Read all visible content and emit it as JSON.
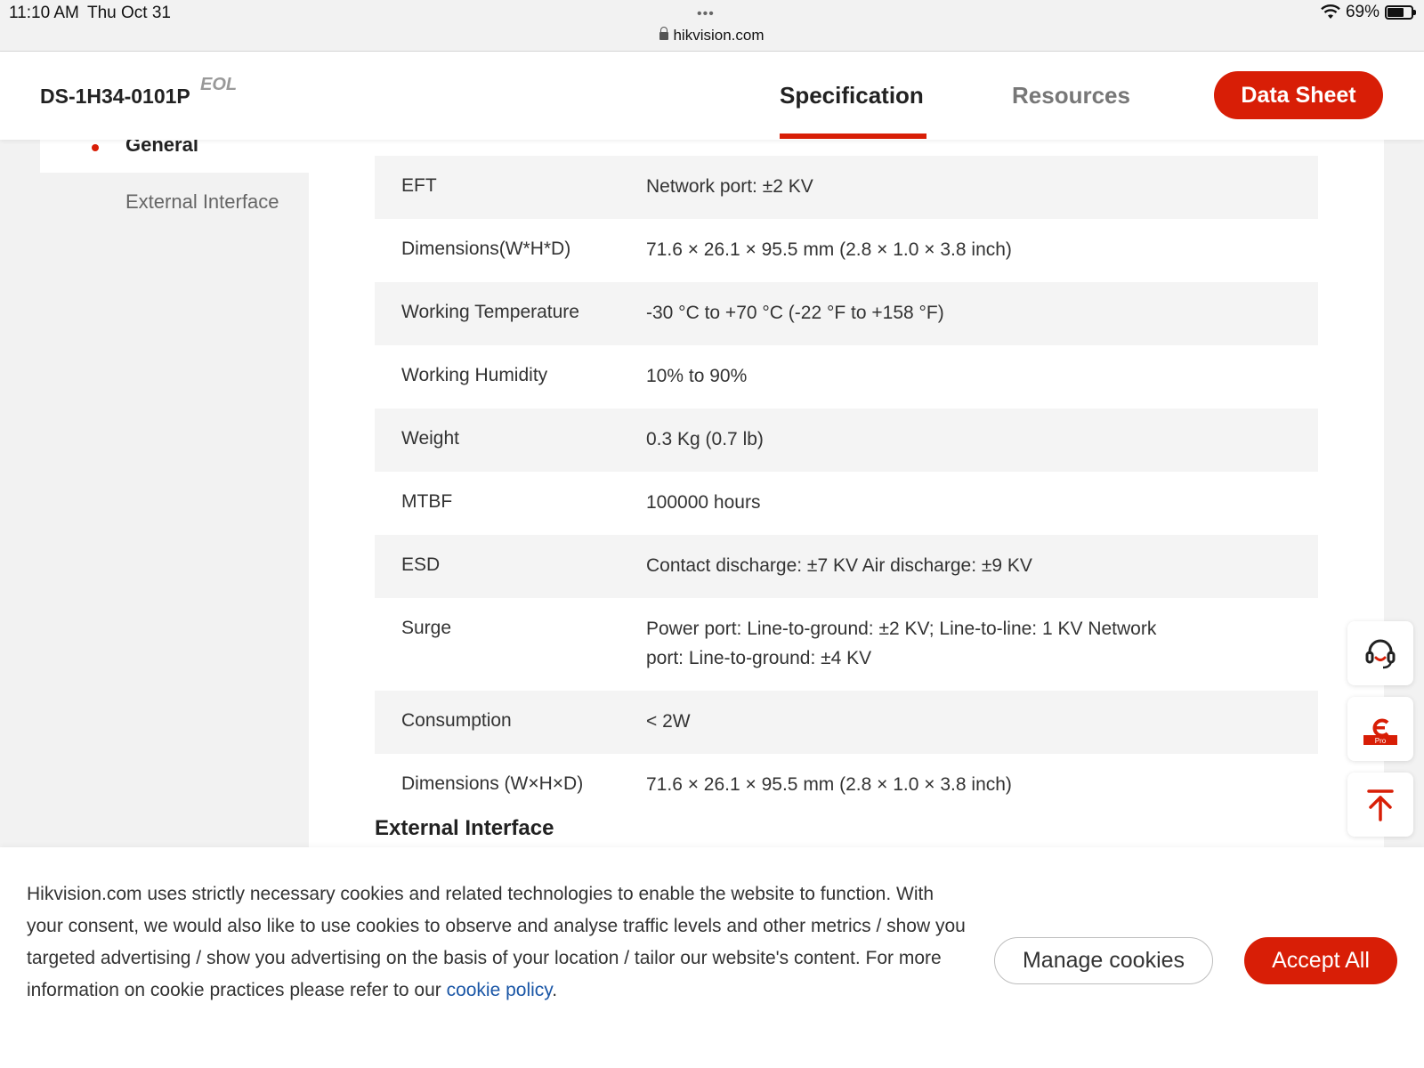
{
  "status_bar": {
    "time": "11:10 AM",
    "date": "Thu Oct 31",
    "dots": "•••",
    "url": "hikvision.com",
    "battery": "69%",
    "battery_level": 0.69
  },
  "header": {
    "model": "DS-1H34-0101P",
    "badge": "EOL",
    "tabs": [
      {
        "label": "Specification",
        "active": true
      },
      {
        "label": "Resources",
        "active": false
      }
    ],
    "datasheet_button": "Data Sheet"
  },
  "sidebar": {
    "items": [
      {
        "label": "General",
        "active": true
      },
      {
        "label": "External Interface",
        "active": false
      }
    ]
  },
  "specs": {
    "rows": [
      {
        "key": "EFT",
        "value": "Network port: ±2 KV"
      },
      {
        "key": "Dimensions(W*H*D)",
        "value": "71.6 × 26.1 × 95.5 mm (2.8 × 1.0 × 3.8 inch)"
      },
      {
        "key": "Working Temperature",
        "value": "-30 °C to +70 °C (-22 °F to +158 °F)"
      },
      {
        "key": "Working Humidity",
        "value": "10% to 90%"
      },
      {
        "key": "Weight",
        "value": "0.3 Kg (0.7 lb)"
      },
      {
        "key": "MTBF",
        "value": "100000 hours"
      },
      {
        "key": "ESD",
        "value": "Contact discharge: ±7 KV Air discharge: ±9 KV"
      },
      {
        "key": "Surge",
        "value": "Power port: Line-to-ground: ±2 KV; Line-to-line: 1 KV Network port: Line-to-ground: ±4 KV"
      },
      {
        "key": "Consumption",
        "value": "< 2W"
      },
      {
        "key": "Dimensions (W×H×D)",
        "value": "71.6 × 26.1 × 95.5 mm (2.8 × 1.0 × 3.8 inch)"
      }
    ],
    "next_section_title": "External Interface"
  },
  "floating_buttons": {
    "support_icon": "headset-icon",
    "pro_icon": "pro-app-icon",
    "pro_label": "Pro",
    "top_icon": "back-to-top-icon"
  },
  "cookie_banner": {
    "text": "Hikvision.com uses strictly necessary cookies and related technologies to enable the website to function. With your consent, we would also like to use cookies to observe and analyse traffic levels and other metrics / show you targeted advertising / show you advertising on the basis of your location / tailor our website's content. For more information on cookie practices please refer to our ",
    "link": "cookie policy",
    "text_end": ".",
    "manage_button": "Manage cookies",
    "accept_button": "Accept All"
  },
  "colors": {
    "accent": "#d81e06",
    "link": "#1a56a6",
    "row_alt": "#f4f4f4",
    "page_bg": "#f2f2f2"
  }
}
